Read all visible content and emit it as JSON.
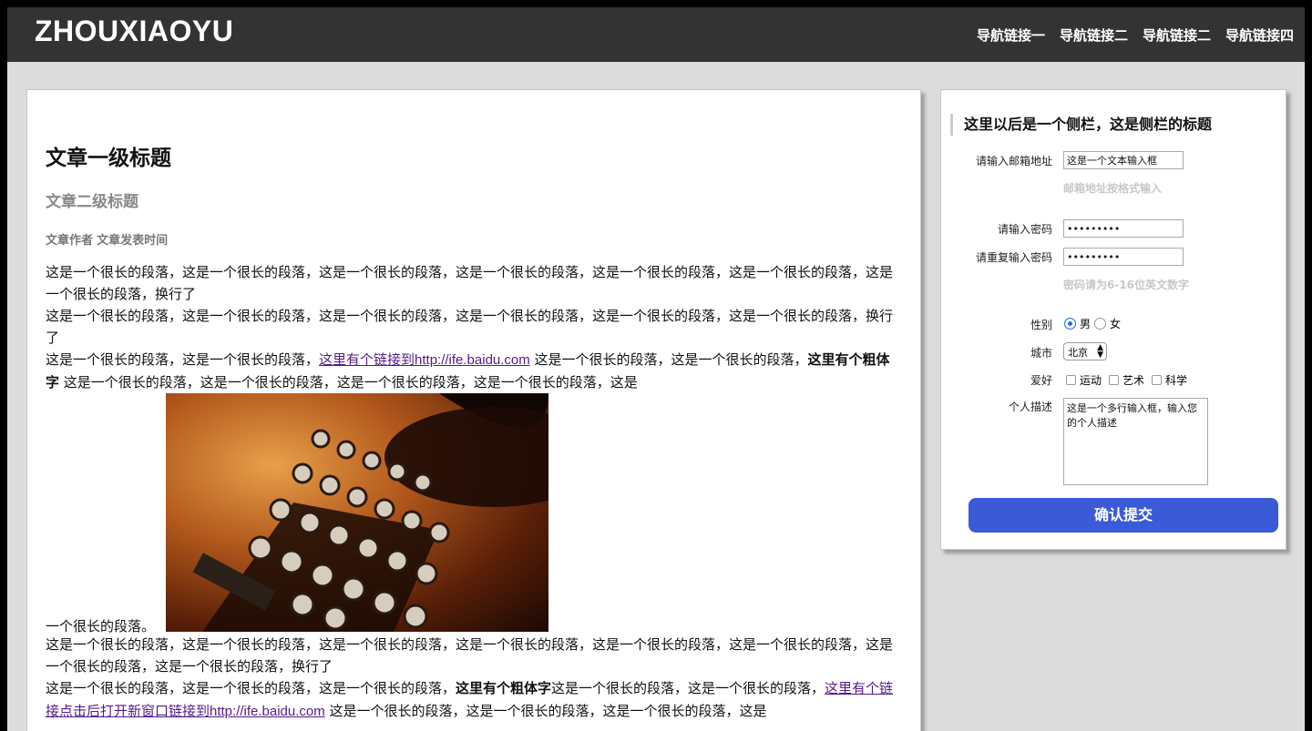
{
  "header": {
    "logo": "ZHOUXIAOYU",
    "nav": [
      "导航链接一",
      "导航链接二",
      "导航链接二",
      "导航链接四"
    ]
  },
  "article": {
    "h1": "文章一级标题",
    "h2": "文章二级标题",
    "author": "文章作者",
    "time": "文章发表时间",
    "p1": "这是一个很长的段落，这是一个很长的段落，这是一个很长的段落，这是一个很长的段落，这是一个很长的段落，这是一个很长的段落，这是一个很长的段落，换行了",
    "p2": "这是一个很长的段落，这是一个很长的段落，这是一个很长的段落，这是一个很长的段落，这是一个很长的段落，这是一个很长的段落，换行了",
    "p3_a": "这是一个很长的段落，这是一个很长的段落，",
    "p3_link": "这里有个链接到http://ife.baidu.com",
    "p3_b": " 这是一个很长的段落，这是一个很长的段落，",
    "p3_bold": "这里有个粗体字",
    "p3_c": " 这是一个很长的段落，这是一个很长的段落，这是一个很长的段落，这是一个很长的段落，这是",
    "p3_tail": "一个很长的段落。",
    "p4": "这是一个很长的段落，这是一个很长的段落，这是一个很长的段落，这是一个很长的段落，这是一个很长的段落，这是一个很长的段落，这是一个很长的段落，这是一个很长的段落，换行了",
    "p5_a": "这是一个很长的段落，这是一个很长的段落，这是一个很长的段落，",
    "p5_bold": "这里有个粗体字",
    "p5_b": "这是一个很长的段落，这是一个很长的段落，",
    "p5_link": "这里有个链接点击后打开新窗口链接到http://ife.baidu.com",
    "p5_c": " 这是一个很长的段落，这是一个很长的段落，这是一个很长的段落，这是"
  },
  "sidebar": {
    "title": "这里以后是一个侧栏，这是侧栏的标题",
    "email_label": "请输入邮箱地址",
    "email_value": "这是一个文本输入框",
    "email_hint": "邮箱地址按格式输入",
    "pwd_label": "请输入密码",
    "pwd_value": "•••••••••",
    "pwd2_label": "请重复输入密码",
    "pwd2_value": "•••••••••",
    "pwd_hint": "密码请为6-16位英文数字",
    "gender_label": "性别",
    "gender_male": "男",
    "gender_female": "女",
    "city_label": "城市",
    "city_value": "北京",
    "hobby_label": "爱好",
    "hobbies": [
      "运动",
      "艺术",
      "科学"
    ],
    "desc_label": "个人描述",
    "desc_value": "这是一个多行输入框，输入您的个人描述",
    "submit": "确认提交"
  }
}
